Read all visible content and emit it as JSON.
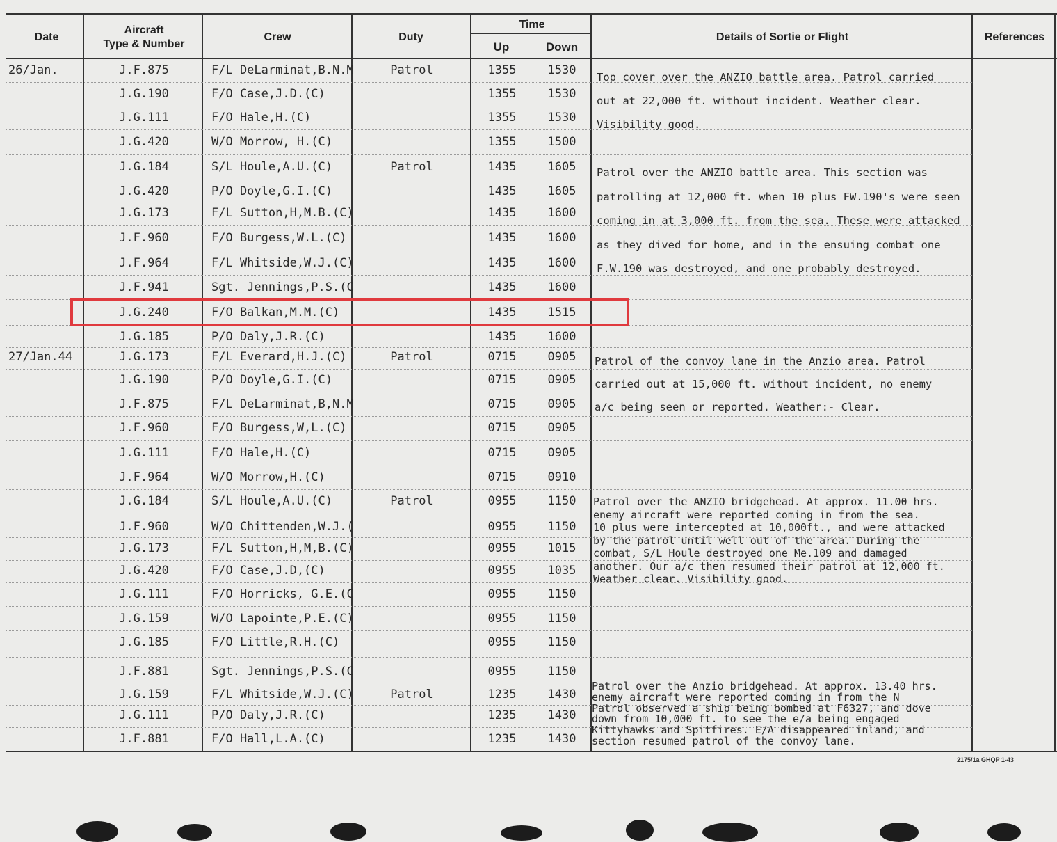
{
  "headers": {
    "date": "Date",
    "aircraft_line1": "Aircraft",
    "aircraft_line2": "Type & Number",
    "crew": "Crew",
    "duty": "Duty",
    "time": "Time",
    "up": "Up",
    "down": "Down",
    "details": "Details of Sortie or Flight",
    "references": "References"
  },
  "rows": [
    {
      "date": "26/Jan.",
      "aircraft": "J.F.875",
      "crew": "F/L DeLarminat,B.N.M.(C)",
      "duty": "Patrol",
      "up": "1355",
      "down": "1530"
    },
    {
      "date": "",
      "aircraft": "J.G.190",
      "crew": "F/O Case,J.D.(C)",
      "duty": "",
      "up": "1355",
      "down": "1530"
    },
    {
      "date": "",
      "aircraft": "J.G.111",
      "crew": "F/O Hale,H.(C)",
      "duty": "",
      "up": "1355",
      "down": "1530"
    },
    {
      "date": "",
      "aircraft": "J.G.420",
      "crew": "W/O Morrow, H.(C)",
      "duty": "",
      "up": "1355",
      "down": "1500"
    },
    {
      "date": "",
      "aircraft": "J.G.184",
      "crew": "S/L Houle,A.U.(C)",
      "duty": "Patrol",
      "up": "1435",
      "down": "1605"
    },
    {
      "date": "",
      "aircraft": "J.G.420",
      "crew": "P/O Doyle,G.I.(C)",
      "duty": "",
      "up": "1435",
      "down": "1605"
    },
    {
      "date": "",
      "aircraft": "J.G.173",
      "crew": "F/L Sutton,H,M.B.(C)",
      "duty": "",
      "up": "1435",
      "down": "1600"
    },
    {
      "date": "",
      "aircraft": "J.F.960",
      "crew": "F/O Burgess,W.L.(C)",
      "duty": "",
      "up": "1435",
      "down": "1600"
    },
    {
      "date": "",
      "aircraft": "J.F.964",
      "crew": "F/L Whitside,W.J.(C)",
      "duty": "",
      "up": "1435",
      "down": "1600"
    },
    {
      "date": "",
      "aircraft": "J.F.941",
      "crew": "Sgt. Jennings,P.S.(C)",
      "duty": "",
      "up": "1435",
      "down": "1600"
    },
    {
      "date": "",
      "aircraft": "J.G.240",
      "crew": "F/O Balkan,M.M.(C)",
      "duty": "",
      "up": "1435",
      "down": "1515"
    },
    {
      "date": "",
      "aircraft": "J.G.185",
      "crew": "P/O Daly,J.R.(C)",
      "duty": "",
      "up": "1435",
      "down": "1600"
    },
    {
      "date": "27/Jan.44",
      "aircraft": "J.G.173",
      "crew": "F/L Everard,H.J.(C)",
      "duty": "Patrol",
      "up": "0715",
      "down": "0905"
    },
    {
      "date": "",
      "aircraft": "J.G.190",
      "crew": "P/O Doyle,G.I.(C)",
      "duty": "",
      "up": "0715",
      "down": "0905"
    },
    {
      "date": "",
      "aircraft": "J.F.875",
      "crew": "F/L DeLarminat,B,N.M.(C)",
      "duty": "",
      "up": "0715",
      "down": "0905"
    },
    {
      "date": "",
      "aircraft": "J.F.960",
      "crew": "F/O Burgess,W,L.(C)",
      "duty": "",
      "up": "0715",
      "down": "0905"
    },
    {
      "date": "",
      "aircraft": "J.G.111",
      "crew": "F/O Hale,H.(C)",
      "duty": "",
      "up": "0715",
      "down": "0905"
    },
    {
      "date": "",
      "aircraft": "J.F.964",
      "crew": "W/O Morrow,H.(C)",
      "duty": "",
      "up": "0715",
      "down": "0910"
    },
    {
      "date": "",
      "aircraft": "J.G.184",
      "crew": "S/L Houle,A.U.(C)",
      "duty": "Patrol",
      "up": "0955",
      "down": "1150"
    },
    {
      "date": "",
      "aircraft": "J.F.960",
      "crew": "W/O Chittenden,W.J.(C)",
      "duty": "",
      "up": "0955",
      "down": "1150"
    },
    {
      "date": "",
      "aircraft": "J.G.173",
      "crew": "F/L Sutton,H,M,B.(C)",
      "duty": "",
      "up": "0955",
      "down": "1015"
    },
    {
      "date": "",
      "aircraft": "J.G.420",
      "crew": "F/O Case,J.D,(C)",
      "duty": "",
      "up": "0955",
      "down": "1035"
    },
    {
      "date": "",
      "aircraft": "J.G.111",
      "crew": "F/O Horricks, G.E.(C)",
      "duty": "",
      "up": "0955",
      "down": "1150"
    },
    {
      "date": "",
      "aircraft": "J.G.159",
      "crew": "W/O Lapointe,P.E.(C)",
      "duty": "",
      "up": "0955",
      "down": "1150"
    },
    {
      "date": "",
      "aircraft": "J.G.185",
      "crew": "F/O Little,R.H.(C)",
      "duty": "",
      "up": "0955",
      "down": "1150"
    },
    {
      "date": "",
      "aircraft": "J.F.881",
      "crew": "Sgt. Jennings,P.S.(C)",
      "duty": "",
      "up": "0955",
      "down": "1150"
    },
    {
      "date": "",
      "aircraft": "J.G.159",
      "crew": "F/L Whitside,W.J.(C)",
      "duty": "Patrol",
      "up": "1235",
      "down": "1430"
    },
    {
      "date": "",
      "aircraft": "J.G.111",
      "crew": "P/O Daly,J.R.(C)",
      "duty": "",
      "up": "1235",
      "down": "1430"
    },
    {
      "date": "",
      "aircraft": "J.F.881",
      "crew": "F/O Hall,L.A.(C)",
      "duty": "",
      "up": "1235",
      "down": "1430"
    }
  ],
  "details": [
    "Top cover over the ANZIO battle area. Patrol carried\nout at 22,000 ft. without incident. Weather clear.\nVisibility good.",
    "Patrol over the ANZIO battle area. This section was\npatrolling at 12,000 ft. when 10 plus FW.190's were seen\ncoming in at 3,000 ft. from the sea. These were attacked\nas they dived for home, and in the ensuing combat one\nF.W.190 was destroyed, and one probably destroyed.",
    "Patrol of the convoy lane in the Anzio area. Patrol\ncarried out at 15,000 ft. without incident, no enemy\na/c being seen or reported. Weather:- Clear.",
    "Patrol over the ANZIO bridgehead. At approx. 11.00 hrs.\nenemy aircraft were reported coming in from the sea.\n10 plus were intercepted at 10,000ft., and were attacked\nby the patrol until well out of the area. During the\ncombat, S/L Houle destroyed one Me.109 and damaged\nanother. Our a/c then resumed their patrol at 12,000 ft.\nWeather clear. Visibility good.",
    "Patrol over the Anzio bridgehead. At approx. 13.40 hrs.\nenemy aircraft were reported coming in from the N\nPatrol observed a ship being bombed at F6327, and dove\ndown from 10,000 ft. to see the e/a being engaged\nKittyhawks and Spitfires. E/A disappeared inland, and\nsection resumed patrol of the convoy lane."
  ],
  "form_code": "2175/1a GHQP 1-43",
  "highlight_color": "#e03a3e"
}
